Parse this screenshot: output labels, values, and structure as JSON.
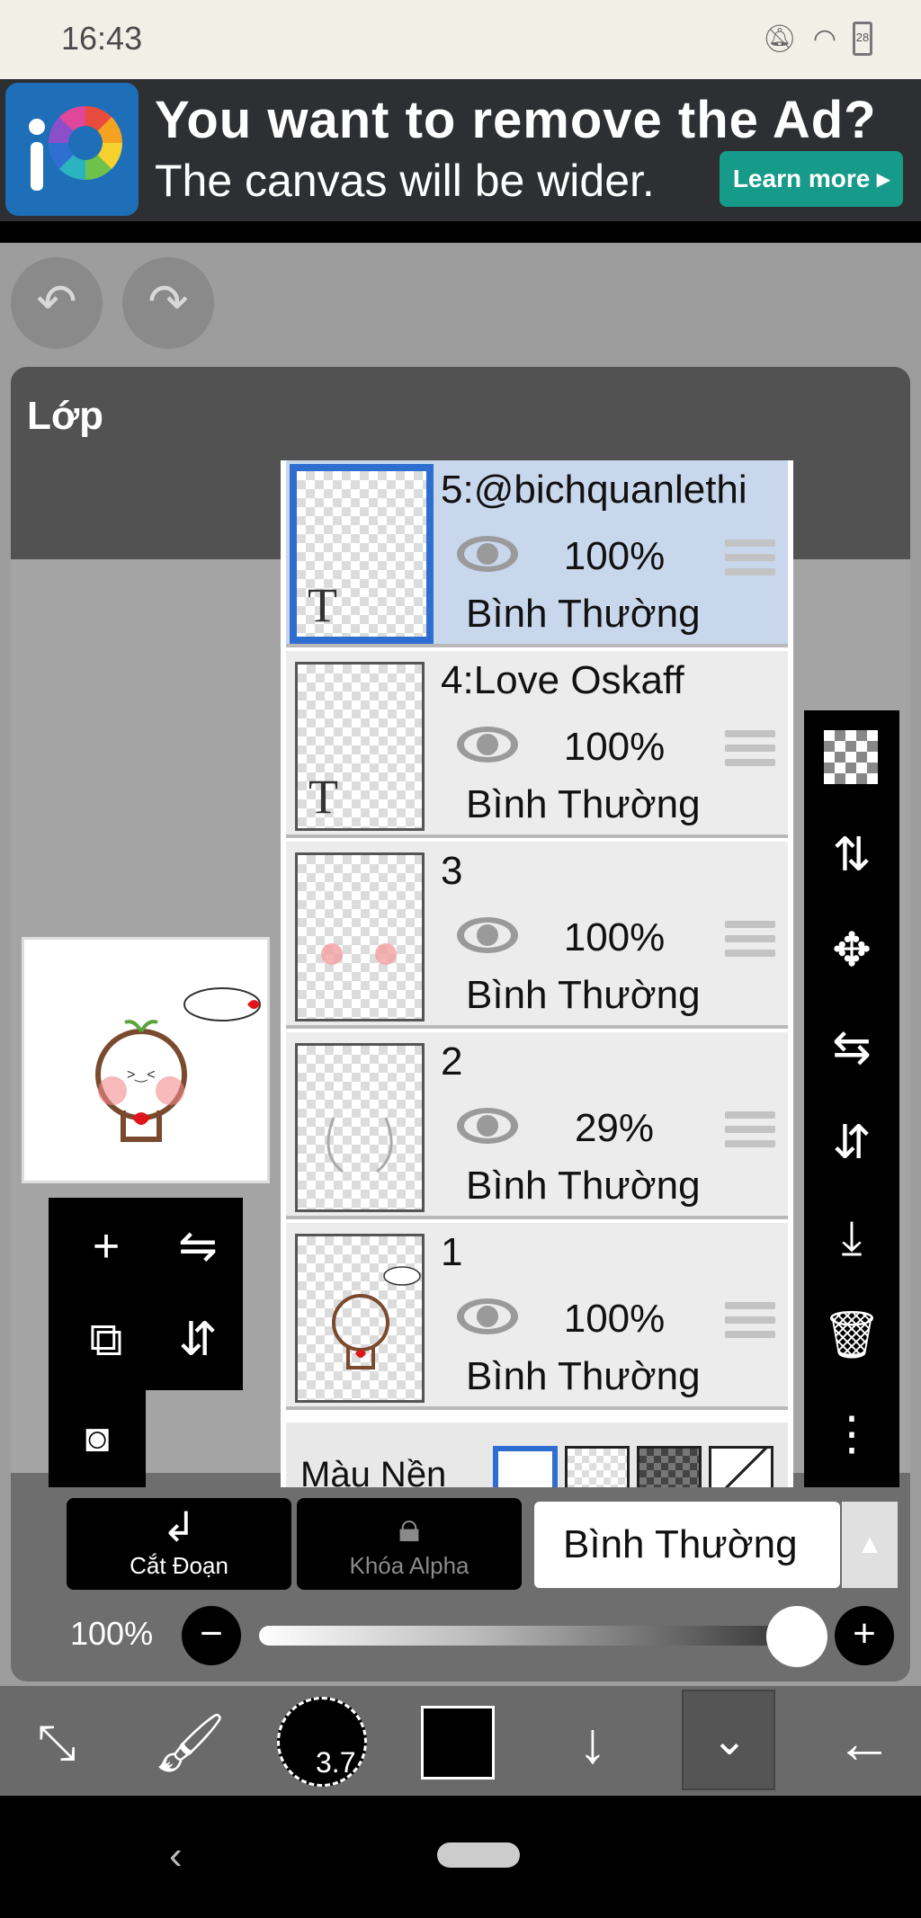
{
  "status_bar": {
    "time": "16:43",
    "battery": "28"
  },
  "ad": {
    "title": "You want to remove the Ad?",
    "subtitle": "The canvas will be wider.",
    "button": "Learn more ▸"
  },
  "panel": {
    "title": "Lớp"
  },
  "layers": [
    {
      "name": "5:@bichquanlethi",
      "opacity": "100%",
      "blend": "Bình Thường",
      "selected": true,
      "thumb_type": "T"
    },
    {
      "name": "4:Love Oskaff",
      "opacity": "100%",
      "blend": "Bình Thường",
      "selected": false,
      "thumb_type": "T"
    },
    {
      "name": "3",
      "opacity": "100%",
      "blend": "Bình Thường",
      "selected": false,
      "thumb_type": "blush"
    },
    {
      "name": "2",
      "opacity": "29%",
      "blend": "Bình Thường",
      "selected": false,
      "thumb_type": "sketch"
    },
    {
      "name": "1",
      "opacity": "100%",
      "blend": "Bình Thường",
      "selected": false,
      "thumb_type": "drawing"
    }
  ],
  "background_row": {
    "label": "Màu Nền"
  },
  "controls": {
    "cut_label": "Cắt Đoạn",
    "alpha_label": "Khóa Alpha",
    "blend_mode": "Bình Thường",
    "opacity_label": "100%",
    "opacity_value": 1.0
  },
  "bottom_bar": {
    "brush_size": "3.7"
  },
  "icons": {
    "undo": "undo-icon",
    "redo": "redo-icon",
    "right_bar": [
      "checker-icon",
      "swap-layer-icon",
      "move-icon",
      "flip-horizontal-icon",
      "flip-vertical-icon",
      "merge-down-icon",
      "trash-icon",
      "more-icon"
    ]
  },
  "colors": {
    "accent": "#2f6ed1",
    "selected_row": "#c9d7ec",
    "ad_button": "#169a8a"
  }
}
